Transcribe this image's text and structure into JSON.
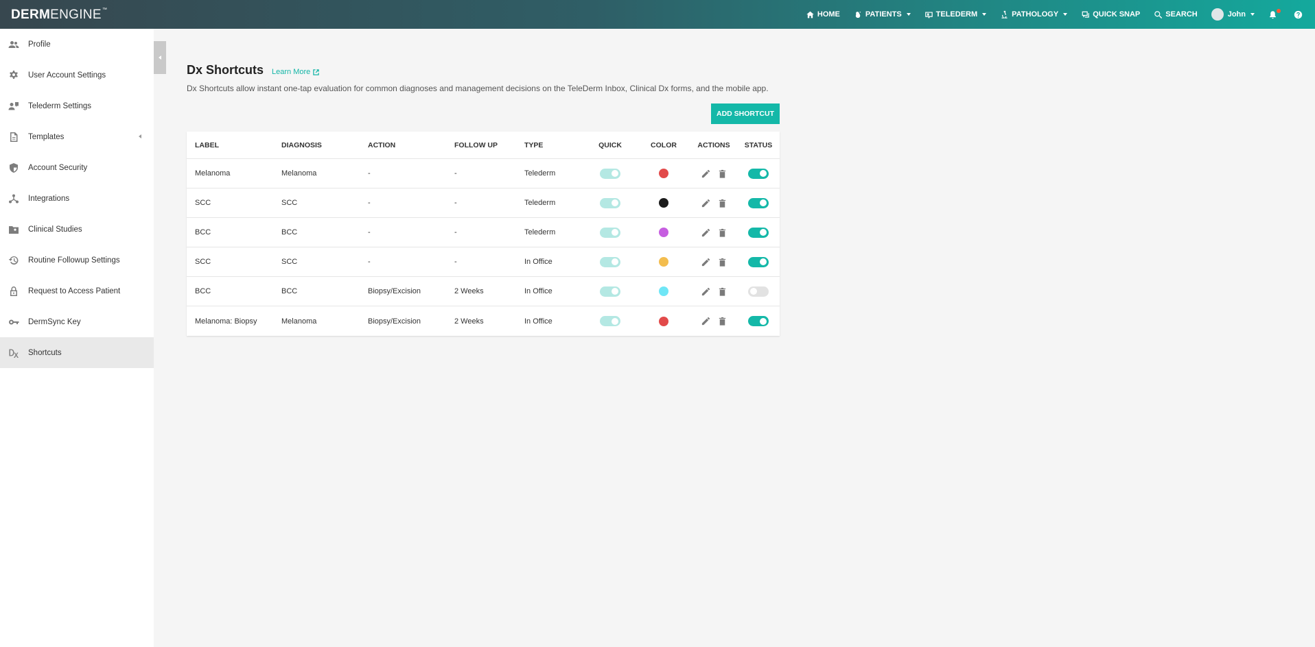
{
  "brand": {
    "bold": "DERM",
    "thin": "ENGINE",
    "tm": "™"
  },
  "nav": [
    {
      "label": "HOME",
      "icon": "home-icon",
      "caret": false
    },
    {
      "label": "PATIENTS",
      "icon": "patients-icon",
      "caret": true
    },
    {
      "label": "TELEDERM",
      "icon": "telederm-icon",
      "caret": true
    },
    {
      "label": "PATHOLOGY",
      "icon": "microscope-icon",
      "caret": true
    },
    {
      "label": "QUICK SNAP",
      "icon": "quick-snap-icon",
      "caret": false
    },
    {
      "label": "SEARCH",
      "icon": "search-icon",
      "caret": false
    }
  ],
  "user": {
    "name": "John"
  },
  "sidebar": {
    "items": [
      {
        "label": "Profile",
        "icon": "profile-icon"
      },
      {
        "label": "User Account Settings",
        "icon": "gear-icon"
      },
      {
        "label": "Telederm Settings",
        "icon": "telederm-settings-icon"
      },
      {
        "label": "Templates",
        "icon": "document-icon"
      },
      {
        "label": "Account Security",
        "icon": "shield-icon"
      },
      {
        "label": "Integrations",
        "icon": "integrations-icon"
      },
      {
        "label": "Clinical Studies",
        "icon": "folder-user-icon"
      },
      {
        "label": "Routine Followup Settings",
        "icon": "history-icon"
      },
      {
        "label": "Request to Access Patient",
        "icon": "lock-icon"
      },
      {
        "label": "DermSync Key",
        "icon": "key-icon"
      },
      {
        "label": "Shortcuts",
        "icon": "dx-icon"
      }
    ],
    "active_index": 10
  },
  "page": {
    "title": "Dx Shortcuts",
    "learn_more": "Learn More",
    "description": "Dx Shortcuts allow instant one-tap evaluation for common diagnoses and management decisions on the TeleDerm Inbox, Clinical Dx forms, and the mobile app.",
    "add_button": "ADD SHORTCUT"
  },
  "table": {
    "headers": [
      "LABEL",
      "DIAGNOSIS",
      "ACTION",
      "FOLLOW UP",
      "TYPE",
      "QUICK",
      "COLOR",
      "ACTIONS",
      "STATUS"
    ],
    "rows": [
      {
        "label": "Melanoma",
        "diagnosis": "Melanoma",
        "action": "-",
        "follow_up": "-",
        "type": "Telederm",
        "quick": true,
        "color": "#e24a4a",
        "status": true
      },
      {
        "label": "SCC",
        "diagnosis": "SCC",
        "action": "-",
        "follow_up": "-",
        "type": "Telederm",
        "quick": true,
        "color": "#1c1c1c",
        "status": true
      },
      {
        "label": "BCC",
        "diagnosis": "BCC",
        "action": "-",
        "follow_up": "-",
        "type": "Telederm",
        "quick": true,
        "color": "#c65ee0",
        "status": true
      },
      {
        "label": "SCC",
        "diagnosis": "SCC",
        "action": "-",
        "follow_up": "-",
        "type": "In Office",
        "quick": true,
        "color": "#f3bd4e",
        "status": true
      },
      {
        "label": "BCC",
        "diagnosis": "BCC",
        "action": "Biopsy/Excision",
        "follow_up": "2 Weeks",
        "type": "In Office",
        "quick": true,
        "color": "#6fe6f6",
        "status": false
      },
      {
        "label": "Melanoma: Biopsy",
        "diagnosis": "Melanoma",
        "action": "Biopsy/Excision",
        "follow_up": "2 Weeks",
        "type": "In Office",
        "quick": true,
        "color": "#e24a4a",
        "status": true
      }
    ]
  }
}
